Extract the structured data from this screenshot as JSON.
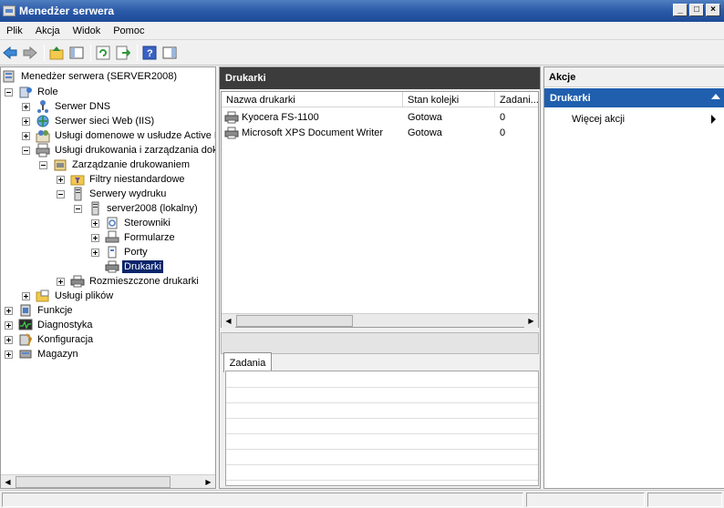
{
  "window": {
    "title": "Menedżer serwera",
    "min": "_",
    "max": "□",
    "close": "×"
  },
  "menu": {
    "items": [
      "Plik",
      "Akcja",
      "Widok",
      "Pomoc"
    ]
  },
  "toolbar": {
    "icons": [
      "back-arrow-icon",
      "forward-arrow-icon",
      "up-folder-icon",
      "show-hide-tree-icon",
      "refresh-icon",
      "export-list-icon",
      "help-icon",
      "show-hide-action-pane-icon"
    ]
  },
  "tree": {
    "root": "Menedżer serwera (SERVER2008)",
    "role": "Role",
    "dns": "Serwer DNS",
    "iis": "Serwer sieci Web (IIS)",
    "ad": "Usługi domenowe w usłudze Active D",
    "print_services": "Usługi drukowania i zarządzania doku",
    "print_mgmt": "Zarządzanie drukowaniem",
    "custom_filters": "Filtry niestandardowe",
    "print_servers": "Serwery wydruku",
    "server_local": "server2008 (lokalny)",
    "drivers": "Sterowniki",
    "forms": "Formularze",
    "ports": "Porty",
    "printers": "Drukarki",
    "deployed": "Rozmieszczone drukarki",
    "file_services": "Usługi plików",
    "features": "Funkcje",
    "diagnostics": "Diagnostyka",
    "configuration": "Konfiguracja",
    "storage": "Magazyn"
  },
  "middle": {
    "header": "Drukarki",
    "columns": [
      "Nazwa drukarki",
      "Stan kolejki",
      "Zadani..."
    ],
    "rows": [
      {
        "name": "Kyocera FS-1100",
        "status": "Gotowa",
        "jobs": "0"
      },
      {
        "name": "Microsoft XPS Document Writer",
        "status": "Gotowa",
        "jobs": "0"
      }
    ],
    "tab": "Zadania"
  },
  "actions": {
    "header": "Akcje",
    "section": "Drukarki",
    "more": "Więcej akcji"
  },
  "colors": {
    "title_bar": "#2b5aa8",
    "middle_header": "#3c3c3c",
    "actions_section": "#1f5fae",
    "selection": "#0a246a"
  }
}
